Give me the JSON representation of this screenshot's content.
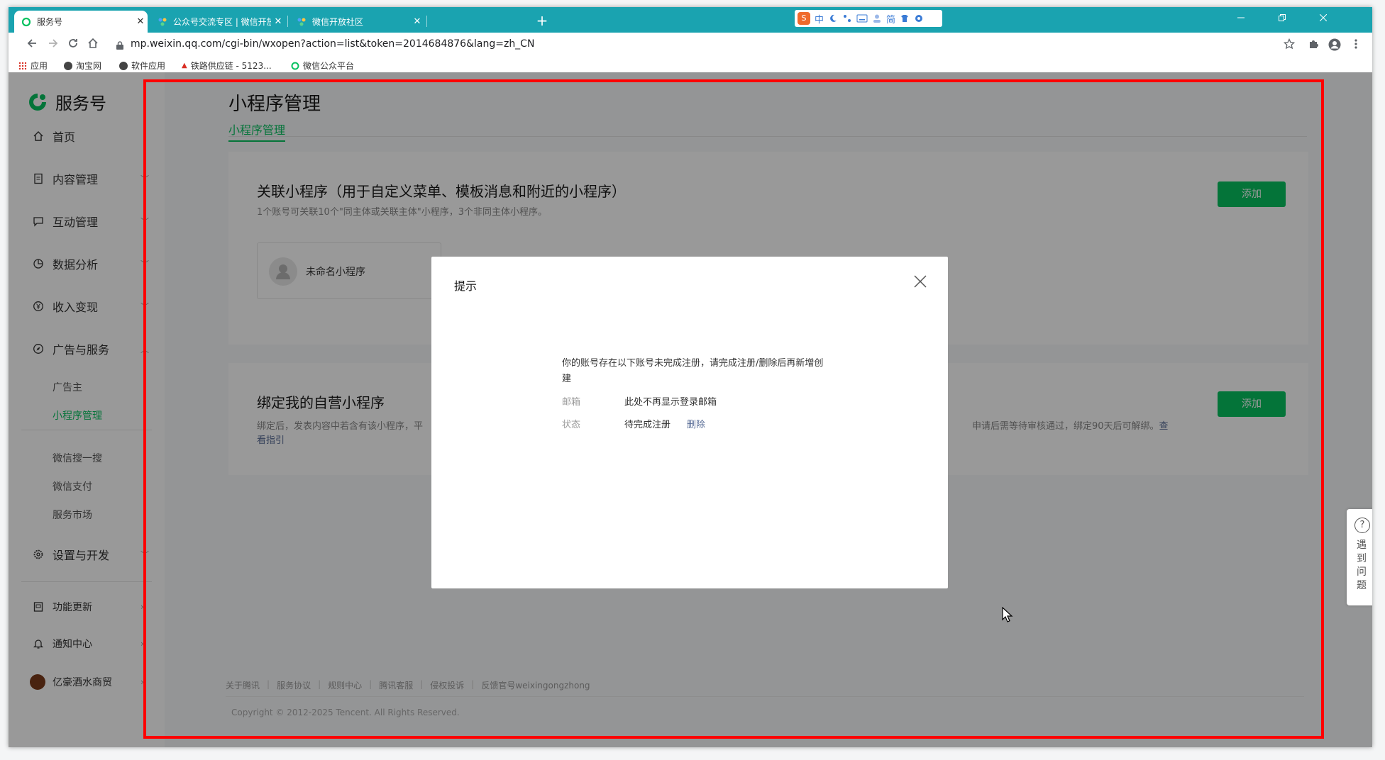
{
  "browser": {
    "tabs": [
      {
        "title": "服务号",
        "active": true
      },
      {
        "title": "公众号交流专区 | 微信开放社区",
        "active": false
      },
      {
        "title": "微信开放社区",
        "active": false
      }
    ],
    "close_glyph": "✕",
    "new_tab_glyph": "+",
    "url": "mp.weixin.qq.com/cgi-bin/wxopen?action=list&token=2014684876&lang=zh_CN",
    "ime": {
      "labels": [
        "中",
        "简"
      ]
    },
    "bookmarks": [
      "应用",
      "淘宝网",
      "软件应用",
      "铁路供应链 - 5123...",
      "微信公众平台"
    ]
  },
  "sidebar": {
    "brand": "服务号",
    "items": [
      {
        "label": "首页",
        "icon": "home-icon"
      },
      {
        "label": "内容管理",
        "icon": "document-icon"
      },
      {
        "label": "互动管理",
        "icon": "message-icon"
      },
      {
        "label": "数据分析",
        "icon": "pie-chart-icon"
      },
      {
        "label": "收入变现",
        "icon": "yen-icon"
      },
      {
        "label": "广告与服务",
        "icon": "compass-icon"
      }
    ],
    "ad_sub": [
      "广告主",
      "小程序管理"
    ],
    "service_sub": [
      "微信搜一搜",
      "微信支付",
      "服务市场"
    ],
    "settings": "设置与开发",
    "bottom": [
      "功能更新",
      "通知中心"
    ],
    "account": "亿豪酒水商贸"
  },
  "main": {
    "title": "小程序管理",
    "tab": "小程序管理",
    "card1": {
      "title": "关联小程序（用于自定义菜单、模板消息和附近的小程序）",
      "desc": "1个账号可关联10个\"同主体或关联主体\"小程序，3个非同主体小程序。",
      "add": "添加",
      "item_name": "未命名小程序"
    },
    "card2": {
      "title": "绑定我的自营小程序",
      "desc_left": "绑定后，发表内容中若含有该小程序，平",
      "desc_right": "申请后需等待审核通过，绑定90天后可解绑。",
      "link_tail": "查",
      "link_next": "看指引",
      "add": "添加"
    },
    "footer": [
      "关于腾讯",
      "服务协议",
      "规则中心",
      "腾讯客服",
      "侵权投诉",
      "反馈官号weixingongzhong"
    ],
    "copyright": "Copyright © 2012-2025 Tencent. All Rights Reserved."
  },
  "modal": {
    "title": "提示",
    "message": "你的账号存在以下账号未完成注册，请完成注册/删除后再新增创建",
    "email_label": "邮箱",
    "email_value": "此处不再显示登录邮箱",
    "status_label": "状态",
    "status_value": "待完成注册",
    "delete_label": "删除"
  },
  "help": {
    "label": "遇到问题",
    "glyph": "?"
  },
  "colors": {
    "brand_green": "#07c160",
    "chrome_teal": "#1aa3b0",
    "highlight_red": "#ff0000",
    "link": "#576b95"
  }
}
